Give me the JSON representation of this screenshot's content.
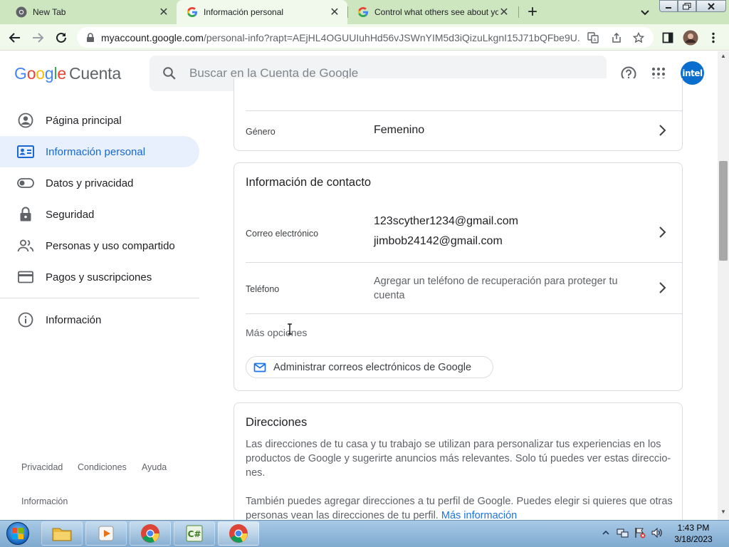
{
  "browser": {
    "tabs": [
      {
        "title": "New Tab",
        "active": false
      },
      {
        "title": "Información personal",
        "active": true
      },
      {
        "title": "Control what others see about yo",
        "active": false
      }
    ],
    "url_host": "myaccount.google.com",
    "url_rest": "/personal-info?rapt=AEjHL4OGUUIuhHd56vJSWnYIM5d3iQizuLkgnI15J71bQFbe9U..."
  },
  "header": {
    "logo_google": [
      "G",
      "o",
      "o",
      "g",
      "l",
      "e"
    ],
    "logo_suffix": "Cuenta",
    "search_placeholder": "Buscar en la Cuenta de Google",
    "avatar_text": "intel"
  },
  "sidebar": {
    "items": [
      {
        "label": "Página principal",
        "icon": "home-icon",
        "active": false
      },
      {
        "label": "Información personal",
        "icon": "id-card-icon",
        "active": true
      },
      {
        "label": "Datos y privacidad",
        "icon": "toggle-icon",
        "active": false
      },
      {
        "label": "Seguridad",
        "icon": "lock-icon",
        "active": false
      },
      {
        "label": "Personas y uso compartido",
        "icon": "people-icon",
        "active": false
      },
      {
        "label": "Pagos y suscripciones",
        "icon": "credit-card-icon",
        "active": false
      },
      {
        "label": "Información",
        "icon": "info-icon",
        "active": false
      }
    ],
    "footer": {
      "privacy": "Privacidad",
      "terms": "Condiciones",
      "help": "Ayuda",
      "about": "Información"
    }
  },
  "basic_info": {
    "gender_label": "Género",
    "gender_value": "Femenino"
  },
  "contact": {
    "title": "Información de contacto",
    "email_label": "Correo electrónico",
    "emails": [
      "123scyther1234@gmail.com",
      "jimbob24142@gmail.com"
    ],
    "phone_label": "Teléfono",
    "phone_value": "Agregar un teléfono de recuperación para proteger tu cuenta",
    "more_options": "Más opciones",
    "manage_emails": "Administrar correos electrónicos de Google"
  },
  "addresses": {
    "title": "Direcciones",
    "paragraph1": "Las direcciones de tu casa y tu trabajo se utilizan para personalizar tus experiencias en los productos de Google y sugerirte anuncios más relevantes. Solo tú puedes ver estas direccio-nes.",
    "paragraph2": "También puedes agregar direcciones a tu perfil de Google. Puedes elegir si quieres que otras personas vean las direcciones de tu perfil.",
    "learn_more": "Más información"
  },
  "taskbar": {
    "time": "1:43 PM",
    "date": "3/18/2023"
  },
  "colors": {
    "accent": "#1a73e8",
    "active_nav_bg": "#e8f0fe",
    "tabstrip": "#cde6c0",
    "toolbar": "#f1f8ec"
  }
}
